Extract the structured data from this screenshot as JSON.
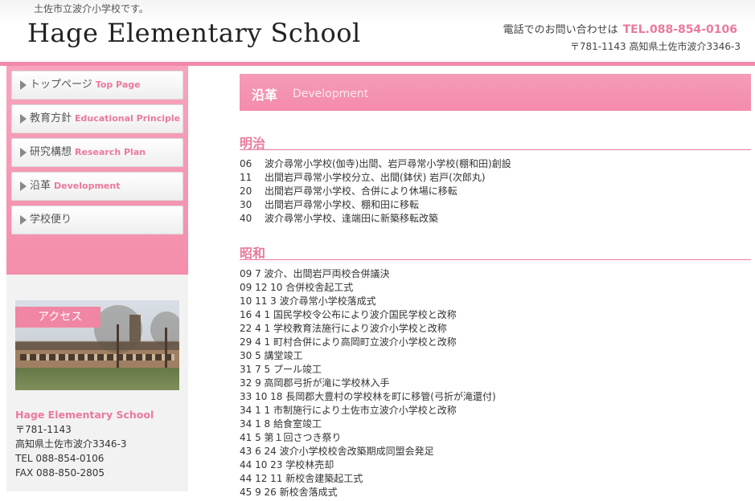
{
  "header": {
    "tagline": "土佐市立波介小学校です。",
    "title": "Hage Elementary School",
    "contact_label": "電話でのお問い合わせは",
    "tel": "TEL.088-854-0106",
    "address": "〒781-1143 高知県土佐市波介3346-3"
  },
  "sidebar": {
    "items": [
      {
        "jp": "トップページ",
        "en": "Top Page"
      },
      {
        "jp": "教育方針",
        "en": "Educational Principle"
      },
      {
        "jp": "研究構想",
        "en": "Research Plan"
      },
      {
        "jp": "沿革",
        "en": "Development"
      },
      {
        "jp": "学校便り",
        "en": ""
      }
    ],
    "access_label": "アクセス",
    "school": {
      "name": "Hage Elementary School",
      "postal": "〒781-1143",
      "address": "高知県土佐市波介3346-3",
      "tel": "TEL 088-854-0106",
      "fax": "FAX 088-850-2805"
    }
  },
  "main": {
    "title_jp": "沿革",
    "title_en": "Development",
    "eras": [
      {
        "name": "明治",
        "events": [
          {
            "date": "06",
            "text": "波介尋常小学校(伽寺)出間、岩戸尋常小学校(棚和田)創設"
          },
          {
            "date": "11",
            "text": "出間岩戸尋常小学校分立、出間(鉢伏) 岩戸(次郎丸)"
          },
          {
            "date": "20",
            "text": "出間岩戸尋常小学校、合併により休場に移転"
          },
          {
            "date": "30",
            "text": "出間岩戸尋常小学校、棚和田に移転"
          },
          {
            "date": "40",
            "text": "波介尋常小学校、逢端田に新築移転改築"
          }
        ]
      },
      {
        "name": "昭和",
        "events": [
          {
            "date": "09 7",
            "text": "波介、出間岩戸両校合併議決"
          },
          {
            "date": "09 12 10",
            "text": "合併校舎起工式"
          },
          {
            "date": "10 11 3",
            "text": "波介尋常小学校落成式"
          },
          {
            "date": "16 4 1",
            "text": "国民学校令公布により波介国民学校と改称"
          },
          {
            "date": "22 4 1",
            "text": "学校教育法施行により波介小学校と改称"
          },
          {
            "date": "29 4 1",
            "text": "町村合併により高岡町立波介小学校と改称"
          },
          {
            "date": "30 5",
            "text": "講堂竣工"
          },
          {
            "date": "31 7 5",
            "text": "プール竣工"
          },
          {
            "date": "32 9",
            "text": "高岡郡弓折が滝に学校林入手"
          },
          {
            "date": "33 10 18",
            "text": "長岡郡大豊村の学校林を町に移管(弓折が滝還付)"
          },
          {
            "date": "34 1 1",
            "text": "市制施行により土佐市立波介小学校と改称"
          },
          {
            "date": "34 1 8",
            "text": "給食室竣工"
          },
          {
            "date": "41 5",
            "text": "第１回さつき祭り"
          },
          {
            "date": "43 6 24",
            "text": "波介小学校校舎改築期成同盟会発足"
          },
          {
            "date": "44 10 23",
            "text": "学校林売却"
          },
          {
            "date": "44 12 11",
            "text": "新校舎建築起工式"
          },
          {
            "date": "45 9 26",
            "text": "新校舎落成式"
          }
        ]
      }
    ]
  },
  "colors": {
    "accent": "#e97a9b",
    "banner": "#f48cab",
    "sidebar_bg": "#f48eab",
    "header_rule": "#f08aa8"
  },
  "icons": [
    "nav-arrow-icon"
  ]
}
